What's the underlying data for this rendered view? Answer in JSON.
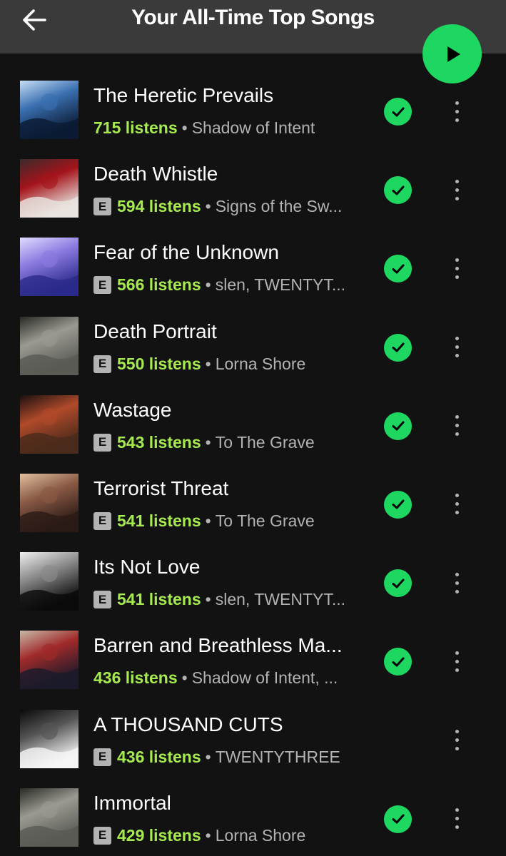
{
  "header": {
    "title": "Your All-Time Top Songs",
    "back_icon": "arrow-left-icon",
    "play_icon": "play-icon",
    "accent": "#1ed760"
  },
  "colors": {
    "background": "#121212",
    "header": "#3a3a3a",
    "listens": "#a6ea4f",
    "secondary": "#b3b3b3"
  },
  "songs": [
    {
      "title": "The Heretic Prevails",
      "explicit": false,
      "listens": "715 listens",
      "artist": "Shadow of Intent",
      "saved": true,
      "cover_palette": [
        "#0a1a33",
        "#3a6fb0",
        "#c6ddf5"
      ]
    },
    {
      "title": "Death Whistle",
      "explicit": true,
      "listens": "594 listens",
      "artist": "Signs of the Sw...",
      "saved": true,
      "cover_palette": [
        "#e8e4df",
        "#a4141b",
        "#3b2a2a"
      ]
    },
    {
      "title": "Fear of the Unknown",
      "explicit": true,
      "listens": "566 listens",
      "artist": "slen, TWENTYT...",
      "saved": true,
      "cover_palette": [
        "#2a2a8a",
        "#8a7ae0",
        "#e0dcff"
      ]
    },
    {
      "title": "Death Portrait",
      "explicit": true,
      "listens": "550 listens",
      "artist": "Lorna Shore",
      "saved": true,
      "cover_palette": [
        "#5a5a55",
        "#9a9a92",
        "#2a2a25"
      ]
    },
    {
      "title": "Wastage",
      "explicit": true,
      "listens": "543 listens",
      "artist": "To The Grave",
      "saved": true,
      "cover_palette": [
        "#4a2a1a",
        "#b04a2a",
        "#1a1010"
      ]
    },
    {
      "title": "Terrorist Threat",
      "explicit": true,
      "listens": "541 listens",
      "artist": "To The Grave",
      "saved": true,
      "cover_palette": [
        "#2a1a15",
        "#8a5a45",
        "#e0c0a0"
      ]
    },
    {
      "title": "Its Not Love",
      "explicit": true,
      "listens": "541 listens",
      "artist": "slen, TWENTYT...",
      "saved": true,
      "cover_palette": [
        "#0a0a0a",
        "#8a8a8a",
        "#f0f0f0"
      ]
    },
    {
      "title": "Barren and Breathless Ma...",
      "explicit": false,
      "listens": "436 listens",
      "artist": "Shadow of Intent, ...",
      "saved": true,
      "cover_palette": [
        "#1a1a2a",
        "#a02a2a",
        "#c8b8a8"
      ]
    },
    {
      "title": "A THOUSAND CUTS",
      "explicit": true,
      "listens": "436 listens",
      "artist": "TWENTYTHREE",
      "saved": false,
      "cover_palette": [
        "#f5f5f5",
        "#555555",
        "#0a0a0a"
      ]
    },
    {
      "title": "Immortal",
      "explicit": true,
      "listens": "429 listens",
      "artist": "Lorna Shore",
      "saved": true,
      "cover_palette": [
        "#5a5a55",
        "#9a9a92",
        "#2a2a25"
      ]
    }
  ],
  "explicit_label": "E",
  "separator": "•"
}
